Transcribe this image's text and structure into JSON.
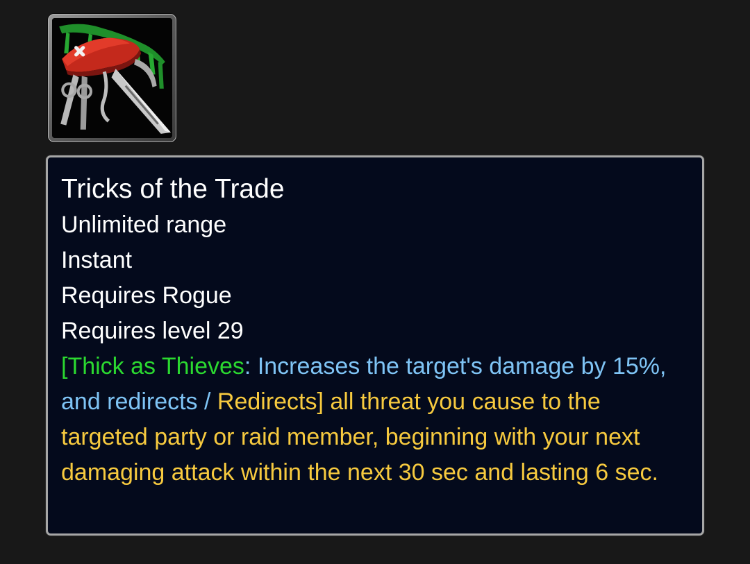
{
  "spell": {
    "icon": "pocket-knife-tools-icon",
    "name": "Tricks of the Trade",
    "range": "Unlimited range",
    "cast_time": "Instant",
    "class_requirement": "Requires Rogue",
    "level_requirement": "Requires level 29",
    "description": {
      "open_bracket": "[",
      "talent_name": "Thick as Thieves",
      "colon": ": ",
      "talent_text": "Increases the target's damage by 15%, and redirects",
      "separator": " / ",
      "base_text": "Redirects",
      "close_bracket": "]",
      "rest": " all threat you cause to the targeted party or raid member, beginning with your next damaging attack within the next 30 sec and lasting 6 sec."
    }
  },
  "colors": {
    "background": "#181818",
    "tooltip_background": "#040a1c",
    "tooltip_border": "#a6a6a6",
    "title_text": "#ffffff",
    "talent_name": "#2bd930",
    "talent_text": "#7fc4f5",
    "description_text": "#f7ca3f"
  }
}
